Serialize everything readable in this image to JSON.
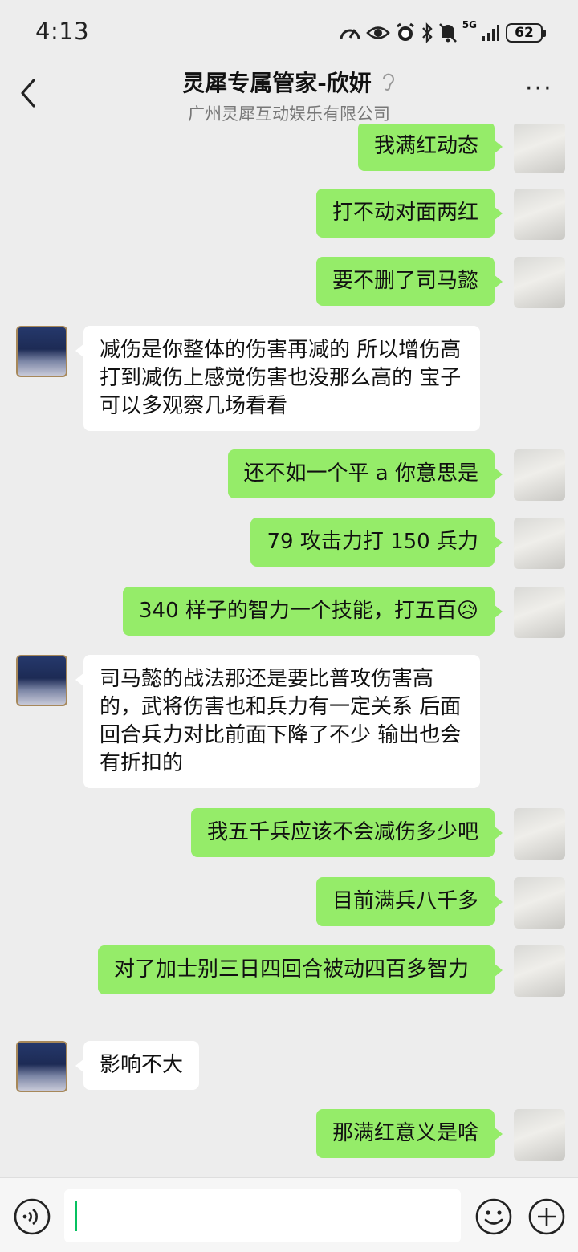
{
  "status_bar": {
    "time": "4:13",
    "network": "5G",
    "battery": "62",
    "icons": [
      "speedometer-icon",
      "eye-icon",
      "alarm-icon",
      "bluetooth-icon",
      "mute-bell-icon",
      "signal-icon",
      "battery-icon"
    ]
  },
  "header": {
    "title": "灵犀专属管家-欣妍",
    "subtitle": "广州灵犀互动娱乐有限公司",
    "back_icon": "chevron-left-icon",
    "ear_icon": "ear-icon",
    "more_label": "···"
  },
  "messages": [
    {
      "side": "right",
      "text": "我满红动态"
    },
    {
      "side": "right",
      "text": "打不动对面两红"
    },
    {
      "side": "right",
      "text": "要不删了司马懿"
    },
    {
      "side": "left",
      "text": "减伤是你整体的伤害再减的 所以增伤高打到减伤上感觉伤害也没那么高的 宝子可以多观察几场看看"
    },
    {
      "side": "right",
      "text": "还不如一个平 a 你意思是"
    },
    {
      "side": "right",
      "text": "79 攻击力打 150 兵力"
    },
    {
      "side": "right",
      "text": "340 样子的智力一个技能，打五百😥"
    },
    {
      "side": "left",
      "text": "司马懿的战法那还是要比普攻伤害高的，武将伤害也和兵力有一定关系 后面回合兵力对比前面下降了不少 输出也会有折扣的"
    },
    {
      "side": "right",
      "text": "我五千兵应该不会减伤多少吧"
    },
    {
      "side": "right",
      "text": "目前满兵八千多"
    },
    {
      "side": "right",
      "text": "对了加士别三日四回合被动四百多智力"
    },
    {
      "side": "left",
      "text": "影响不大"
    },
    {
      "side": "right",
      "text": "那满红意义是啥"
    }
  ],
  "input_bar": {
    "value": "",
    "voice_icon": "voice-icon",
    "emoji_icon": "emoji-icon",
    "plus_icon": "plus-icon"
  },
  "colors": {
    "background": "#ededed",
    "sent_bubble": "#95ec69",
    "received_bubble": "#ffffff",
    "caret": "#07c160"
  }
}
